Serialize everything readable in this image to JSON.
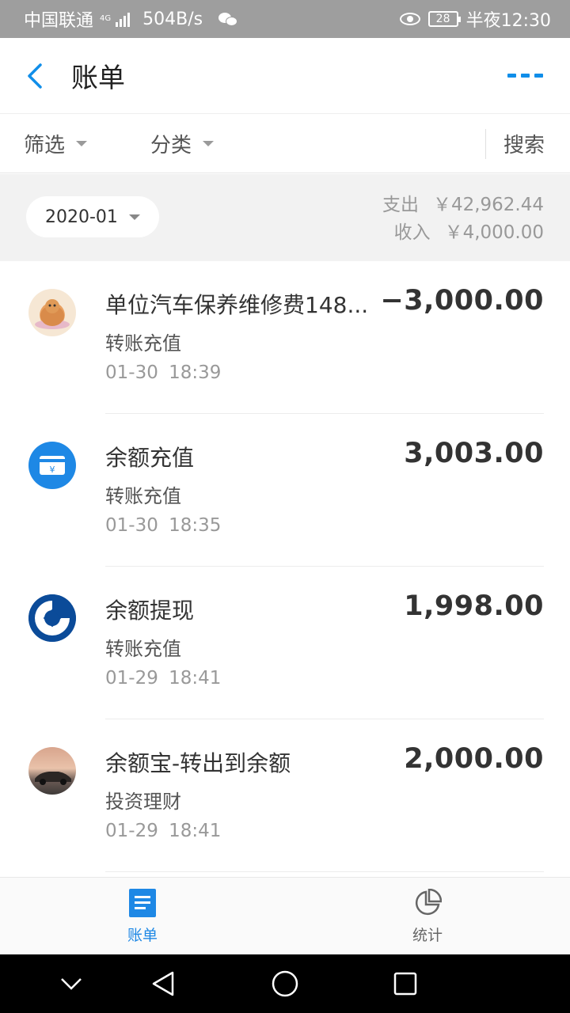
{
  "status_bar": {
    "carrier": "中国联通",
    "network_tag": "4G",
    "speed": "504B/s",
    "battery": "28",
    "time": "半夜12:30"
  },
  "header": {
    "title": "账单"
  },
  "filters": {
    "filter_label": "筛选",
    "category_label": "分类",
    "search_label": "搜索"
  },
  "summary": {
    "month": "2020-01",
    "expense_label": "支出",
    "expense_value": "￥42,962.44",
    "income_label": "收入",
    "income_value": "￥4,000.00"
  },
  "transactions": [
    {
      "name": "单位汽车保养维修费148...",
      "category": "转账充值",
      "time": "01-30  18:39",
      "amount": "−3,000.00",
      "icon": "cat-avatar-icon"
    },
    {
      "name": "余额充值",
      "category": "转账充值",
      "time": "01-30  18:35",
      "amount": "3,003.00",
      "icon": "balance-card-icon"
    },
    {
      "name": "余额提现",
      "category": "转账充值",
      "time": "01-29  18:41",
      "amount": "1,998.00",
      "icon": "ccb-bank-icon"
    },
    {
      "name": "余额宝-转出到余额",
      "category": "投资理财",
      "time": "01-29  18:41",
      "amount": "2,000.00",
      "icon": "car-avatar-icon"
    }
  ],
  "tabs": [
    {
      "label": "账单",
      "icon": "bill-list-icon",
      "active": true
    },
    {
      "label": "统计",
      "icon": "pie-chart-icon",
      "active": false
    }
  ],
  "colors": {
    "accent": "#108ee9",
    "tab_active": "#1e88e5",
    "status_bar": "#9e9e9e"
  }
}
